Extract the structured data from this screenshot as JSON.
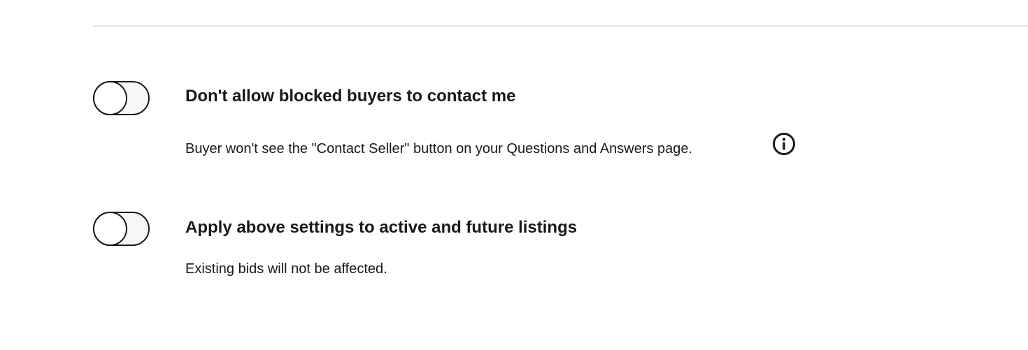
{
  "settings": [
    {
      "title": "Don't allow blocked buyers to contact me",
      "description": "Buyer won't see the \"Contact Seller\" button on your Questions and Answers page.",
      "toggle_on": false,
      "has_info_icon": true
    },
    {
      "title": "Apply above settings to active and future listings",
      "description": "Existing bids will not be affected.",
      "toggle_on": false,
      "has_info_icon": false
    }
  ],
  "icons": {
    "info": "info-circle-icon"
  },
  "colors": {
    "text": "#191919",
    "divider": "#e5e5e5",
    "toggle_track_off": "#f7f7f7",
    "toggle_knob": "#ffffff"
  }
}
